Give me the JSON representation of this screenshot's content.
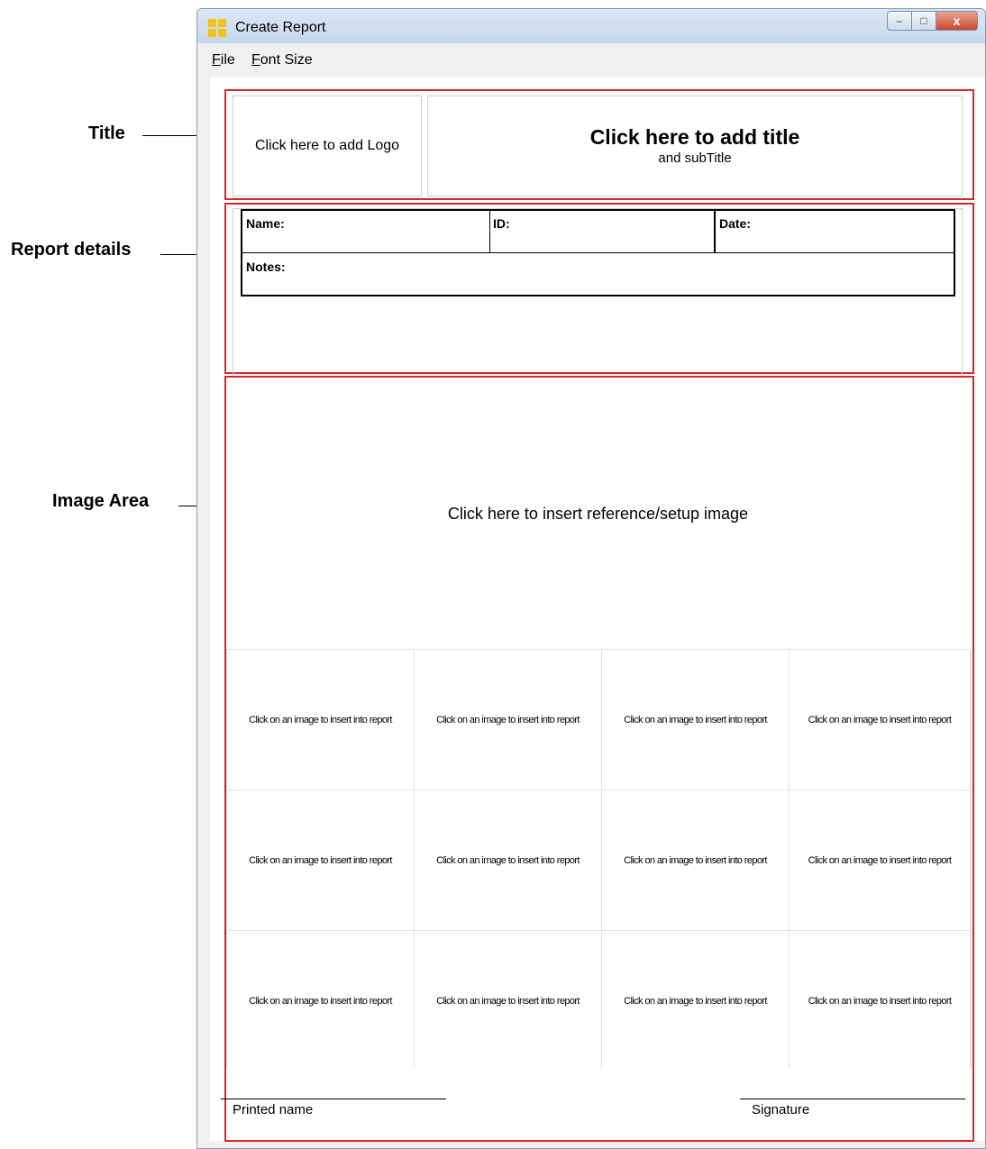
{
  "annotations": {
    "title": "Title",
    "report_details": "Report details",
    "image_area": "Image Area"
  },
  "window": {
    "title": "Create Report",
    "close_glyph": "x",
    "minimize_glyph": "–",
    "maximize_glyph": "□"
  },
  "menu": {
    "file_mnemonic": "F",
    "file_rest": "ile",
    "font_mnemonic": "F",
    "font_rest": "ont Size"
  },
  "header": {
    "logo_placeholder": "Click here to add Logo",
    "title_placeholder": "Click here to add title",
    "subtitle_placeholder": "and subTitle"
  },
  "details": {
    "name_label": "Name:",
    "id_label": "ID:",
    "date_label": "Date:",
    "notes_label": "Notes:"
  },
  "image_area": {
    "reference_placeholder": "Click here to insert reference/setup image",
    "thumbnails": [
      "Click on an image to insert into report",
      "Click on an image to insert into report",
      "Click on an image to insert into report",
      "Click on an image to insert into report",
      "Click on an image to insert into report",
      "Click on an image to insert into report",
      "Click on an image to insert into report",
      "Click on an image to insert into report",
      "Click on an image to insert into report",
      "Click on an image to insert into report",
      "Click on an image to insert into report",
      "Click on an image to insert into report"
    ]
  },
  "footer": {
    "printed_name_label": "Printed name",
    "signature_label": "Signature"
  },
  "colors": {
    "section_border": "#d8262a",
    "app_icon": "#f2c21b"
  }
}
